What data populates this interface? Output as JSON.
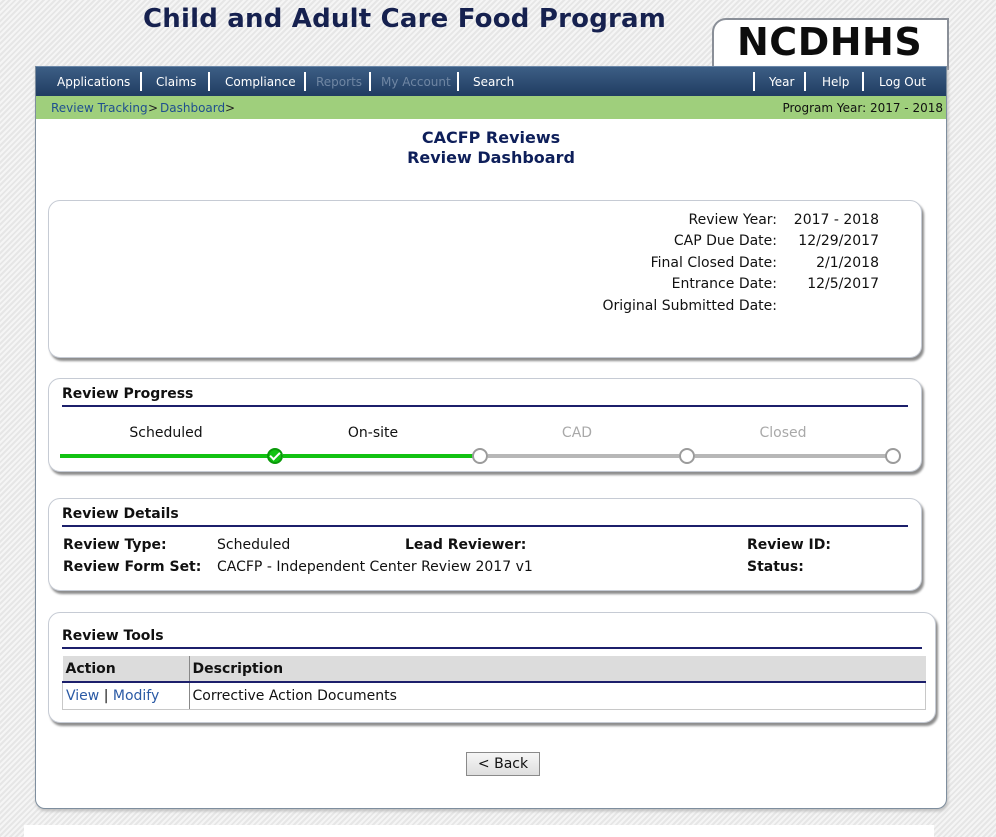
{
  "header": {
    "app_title": "Child and Adult Care Food Program",
    "logo": "NCDHHS"
  },
  "nav": {
    "left_items": [
      {
        "label": "Applications",
        "enabled": true
      },
      {
        "label": "Claims",
        "enabled": true
      },
      {
        "label": "Compliance",
        "enabled": true
      },
      {
        "label": "Reports",
        "enabled": false
      },
      {
        "label": "My Account",
        "enabled": false
      },
      {
        "label": "Search",
        "enabled": true
      }
    ],
    "right_items": [
      {
        "label": "Year"
      },
      {
        "label": "Help"
      },
      {
        "label": "Log Out"
      }
    ]
  },
  "breadcrumb": {
    "items": [
      "Review Tracking",
      "Dashboard"
    ],
    "separator": ">",
    "program_year": "Program Year: 2017 - 2018"
  },
  "page": {
    "title": "CACFP Reviews",
    "subtitle": "Review Dashboard"
  },
  "summary": {
    "fields": [
      {
        "label": "Review Year:",
        "value": "2017 - 2018"
      },
      {
        "label": "CAP Due Date:",
        "value": "12/29/2017"
      },
      {
        "label": "Final Closed Date:",
        "value": "2/1/2018"
      },
      {
        "label": "Entrance Date:",
        "value": "12/5/2017"
      },
      {
        "label": "Original Submitted Date:",
        "value": ""
      }
    ]
  },
  "progress": {
    "heading": "Review Progress",
    "steps": [
      {
        "label": "Scheduled",
        "status": "complete"
      },
      {
        "label": "On-site",
        "status": "complete"
      },
      {
        "label": "CAD",
        "status": "pending"
      },
      {
        "label": "Closed",
        "status": "pending"
      }
    ],
    "colors": {
      "complete": "#12c212",
      "pending": "#b7b7b7"
    }
  },
  "details": {
    "heading": "Review Details",
    "review_type_label": "Review Type:",
    "review_type_value": "Scheduled",
    "lead_reviewer_label": "Lead Reviewer:",
    "lead_reviewer_value": "",
    "review_id_label": "Review ID:",
    "review_id_value": "",
    "form_set_label": "Review Form Set:",
    "form_set_value": "CACFP - Independent Center Review 2017 v1",
    "status_label": "Status:",
    "status_value": ""
  },
  "tools": {
    "heading": "Review Tools",
    "columns": [
      "Action",
      "Description"
    ],
    "rows": [
      {
        "view_label": "View",
        "separator": "|",
        "modify_label": "Modify",
        "description": "Corrective Action Documents"
      }
    ]
  },
  "footer": {
    "back_label": "< Back"
  },
  "colors": {
    "nav_bg": "#1f3b60",
    "breadcrumb_bg": "#9fcf7c",
    "title_color": "#0e1f5a",
    "link_color": "#2b5aa5"
  }
}
